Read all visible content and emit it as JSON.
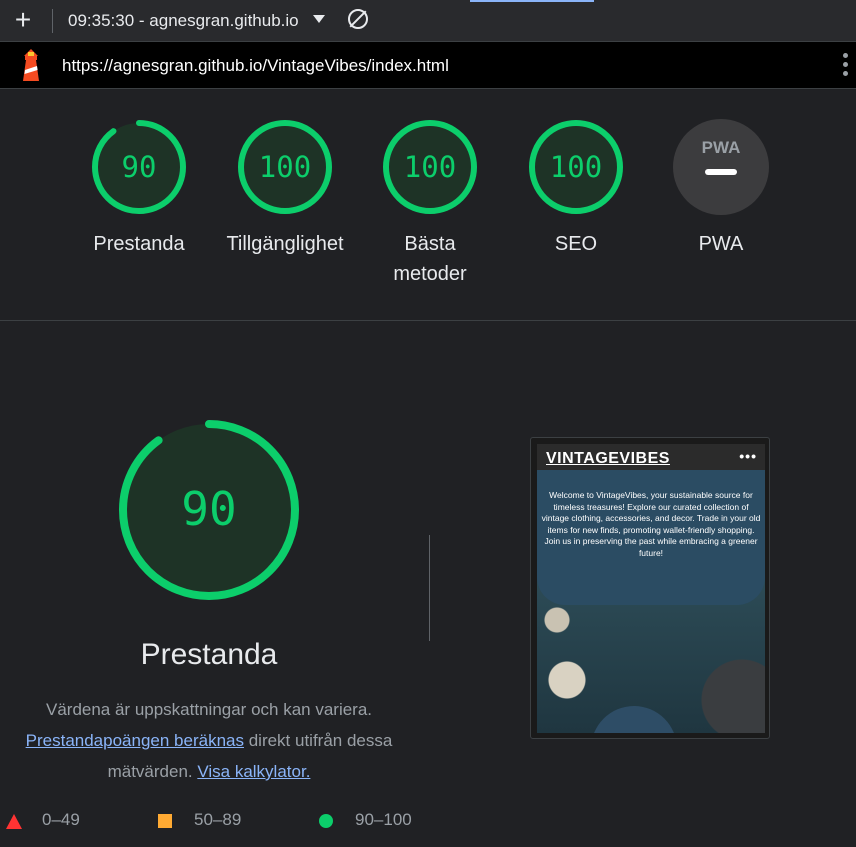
{
  "toolbar": {
    "new_report_icon": "plus-icon",
    "report_label": "09:35:30 - agnesgran.github.io",
    "clear_icon": "block-icon"
  },
  "urlbar": {
    "url": "https://agnesgran.github.io/VintageVibes/index.html"
  },
  "gauges": [
    {
      "label": "Prestanda",
      "score": "90",
      "fraction": 0.9
    },
    {
      "label": "Tillgänglighet",
      "score": "100",
      "fraction": 1.0
    },
    {
      "label": "Bästa metoder",
      "score": "100",
      "fraction": 1.0
    },
    {
      "label": "SEO",
      "score": "100",
      "fraction": 1.0
    },
    {
      "label": "PWA",
      "badge": "PWA"
    }
  ],
  "main": {
    "score": "90",
    "fraction": 0.9,
    "title": "Prestanda",
    "desc_line1": "Värdena är uppskattningar och kan variera.",
    "desc_link1": "Prestandapoängen beräknas",
    "desc_mid": " direkt utifrån dessa mätvärden. ",
    "desc_link2": "Visa kalkylator."
  },
  "thumbnail": {
    "logo": "VINTAGEVIBES",
    "menu": "•••",
    "text": "Welcome to VintageVibes, your sustainable source for timeless treasures! Explore our curated collection of vintage clothing, accessories, and decor. Trade in your old items for new finds, promoting wallet-friendly shopping. Join us in preserving the past while embracing a greener future!"
  },
  "legend": [
    {
      "range": "0–49",
      "color": "#ff3333"
    },
    {
      "range": "50–89",
      "color": "#ffaa33"
    },
    {
      "range": "90–100",
      "color": "#0cce6b"
    }
  ],
  "colors": {
    "pass": "#0cce6b",
    "background": "#202124",
    "link": "#8ab4f8"
  }
}
